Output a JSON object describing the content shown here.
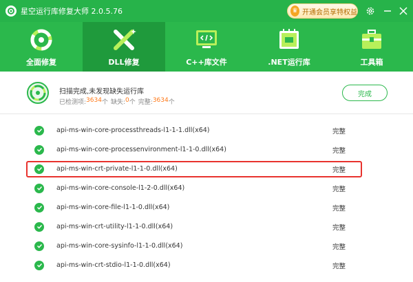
{
  "app": {
    "title": "星空运行库修复大师 2.0.5.76",
    "vip_label": "开通会员享特权益",
    "vip_glyph": "♛"
  },
  "nav": {
    "items": [
      {
        "label": "全面修复",
        "icon": "repair-ring-icon",
        "active": false
      },
      {
        "label": "DLL修复",
        "icon": "dll-tools-icon",
        "active": true
      },
      {
        "label": "C++库文件",
        "icon": "code-monitor-icon",
        "active": false
      },
      {
        "label": ".NET运行库",
        "icon": "net-board-icon",
        "active": false
      },
      {
        "label": "工具箱",
        "icon": "toolbox-icon",
        "active": false
      }
    ]
  },
  "status": {
    "title": "扫描完成,未发现缺失运行库",
    "checked_label": "已检测项:",
    "checked_count": "3634",
    "checked_unit": "个",
    "missing_label": "缺失:",
    "missing_count": "0",
    "missing_unit": "个",
    "complete_label": "完整:",
    "complete_count": "3634",
    "complete_unit": "个",
    "done_button": "完成"
  },
  "rows": [
    {
      "name": "api-ms-win-core-processthreads-l1-1-1.dll(x64)",
      "status": "完整"
    },
    {
      "name": "api-ms-win-core-processenvironment-l1-1-0.dll(x64)",
      "status": "完整"
    },
    {
      "name": "api-ms-win-crt-private-l1-1-0.dll(x64)",
      "status": "完整"
    },
    {
      "name": "api-ms-win-core-console-l1-2-0.dll(x64)",
      "status": "完整"
    },
    {
      "name": "api-ms-win-core-file-l1-1-0.dll(x64)",
      "status": "完整"
    },
    {
      "name": "api-ms-win-crt-utility-l1-1-0.dll(x64)",
      "status": "完整"
    },
    {
      "name": "api-ms-win-core-sysinfo-l1-1-0.dll(x64)",
      "status": "完整"
    },
    {
      "name": "api-ms-win-crt-stdio-l1-1-0.dll(x64)",
      "status": "完整"
    }
  ],
  "colors": {
    "primary": "#2bb84c",
    "nav_active": "#1f9a3c",
    "highlight": "#e8322d",
    "accent_number": "#ff7a1a"
  }
}
